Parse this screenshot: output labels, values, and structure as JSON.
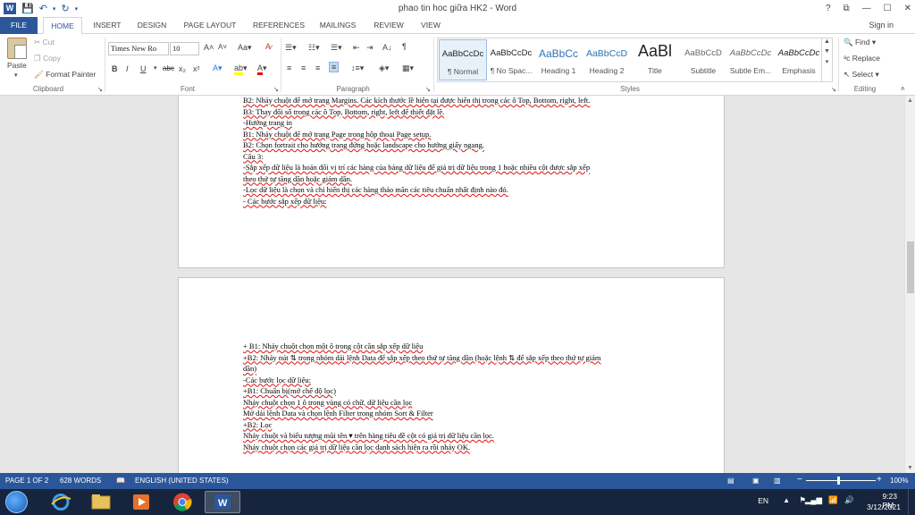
{
  "window": {
    "title": "phao tin hoc giữa HK2 - Word",
    "controls": [
      "?",
      "⧉",
      "—",
      "☐",
      "✕"
    ]
  },
  "tabs": [
    "FILE",
    "HOME",
    "INSERT",
    "DESIGN",
    "PAGE LAYOUT",
    "REFERENCES",
    "MAILINGS",
    "REVIEW",
    "VIEW"
  ],
  "signin": "Sign in",
  "clipboard": {
    "paste": "Paste",
    "cut": "Cut",
    "copy": "Copy",
    "format_painter": "Format Painter",
    "label": "Clipboard"
  },
  "font": {
    "name": "Times New Ro",
    "size": "10",
    "label": "Font",
    "bold": "B",
    "italic": "I",
    "underline": "U",
    "strike": "abc",
    "sub": "x₂",
    "sup": "x²"
  },
  "paragraph": {
    "label": "Paragraph"
  },
  "styles": {
    "label": "Styles",
    "items": [
      {
        "preview": "AaBbCcDc",
        "name": "¶ Normal"
      },
      {
        "preview": "AaBbCcDc",
        "name": "¶ No Spac..."
      },
      {
        "preview": "AaBbCc",
        "name": "Heading 1"
      },
      {
        "preview": "AaBbCcD",
        "name": "Heading 2"
      },
      {
        "preview": "AaBl",
        "name": "Title"
      },
      {
        "preview": "AaBbCcD",
        "name": "Subtitle"
      },
      {
        "preview": "AaBbCcDc",
        "name": "Subtle Em..."
      },
      {
        "preview": "AaBbCcDc",
        "name": "Emphasis"
      }
    ]
  },
  "editing": {
    "find": "Find",
    "replace": "Replace",
    "select": "Select",
    "label": "Editing"
  },
  "page1_lines": [
    "B2: Nháy chuột để mở trang Margins. Các kích thước lề hiện tại được hiển thị trong các ô Top, Bottom, right, left.",
    "B3: Thay đổi số trong các ô Top, Bottom, right, left để thiết đặt lề.",
    "-Hướng trang in",
    "B1: Nháy chuột để mở trang Page trong hộp thoại Page setup.",
    "B2: Chọn fortrait cho hướng trang đứng hoặc landscape cho hướng giấy ngang.",
    "Câu 3:",
    "-Sắp xếp dữ liệu là hoán đổi vị trí các hàng của bảng dữ liệu để giá trị dữ liệu trong 1 hoặc nhiều cột được sắp xếp",
    "theo thứ tự tăng dần hoặc giảm dần.",
    "-Lọc dữ liệu là chọn và chỉ hiển thị các hàng thảo mãn các tiêu chuẩn nhất định nào đó.",
    "- Các bước sắp xếp dữ liệu:"
  ],
  "page2_lines": [
    "+ B1: Nháy chuột chọn một ô trong cột cần sắp xếp dữ liệu",
    "+B2: Nháy nút ⇅ trong nhóm dải lệnh Data để sắp xếp theo thứ tự tăng dần (hoặc lệnh ⇅ để sắp xếp theo thứ tự giảm",
    "dần)",
    "-Các bước lọc dữ liệu:",
    "+B1: Chuẩn bị(mở chế độ lọc)",
    "Nháy chuột chọn 1 ô trong vùng có chữ, dữ liệu cần lọc",
    "Mở dải lệnh Data và chọn lệnh Filter trong nhóm Sort & Filter",
    "+B2: Lọc",
    "Nháy chuột và biểu tượng mũi tên ▾ trên hàng tiêu đề cột có giá trị dữ liệu cần lọc.",
    "Nháy chuột chọn các giá trị dữ liệu cần lọc danh sách hiện ra rồi nháy OK."
  ],
  "status": {
    "page": "PAGE 1 OF 2",
    "words": "628 WORDS",
    "language": "ENGLISH (UNITED STATES)",
    "zoom": "100%",
    "zoom_minus": "−",
    "zoom_plus": "+"
  },
  "taskbar": {
    "lang": "EN",
    "time": "9:23 PM",
    "date": "3/12/2021"
  },
  "colors": {
    "word_blue": "#2b579a",
    "taskbar": "#16253d"
  }
}
